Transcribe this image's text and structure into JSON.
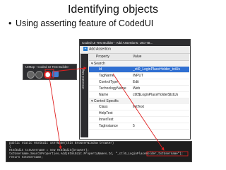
{
  "slide": {
    "title": "Identifying objects",
    "bullet": "Using asserting feature of CodedUI"
  },
  "toolbar": {
    "title": "UIMap - Coded UI Test Builder",
    "icons": [
      "record-icon",
      "pause-icon",
      "target-icon",
      "generate-icon"
    ]
  },
  "window": {
    "title": "Coded UI Test Builder - Add Assertions: UIC+tB...",
    "add_assertion": "Add Assertion",
    "side_tab": "UIControl Map",
    "columns": [
      "Property",
      "Value"
    ],
    "categories": [
      "Search",
      "Control Specific"
    ],
    "rows": [
      {
        "k": "Id",
        "v": "_ctl0_LoginPlaceHolder_txtUs",
        "selected": true
      },
      {
        "k": "TagName",
        "v": "INPUT"
      },
      {
        "k": "ControlType",
        "v": "Edit"
      },
      {
        "k": "TechnologyName",
        "v": "Web"
      },
      {
        "k": "Name",
        "v": "ctl0$LoginPlaceHolder$txtUs"
      }
    ],
    "rows2": [
      {
        "k": "Class",
        "v": "InitText"
      },
      {
        "k": "HelpText",
        "v": ""
      },
      {
        "k": "InnerText",
        "v": ""
      },
      {
        "k": "TagInstance",
        "v": "5"
      }
    ]
  },
  "code": {
    "lines": [
      "public static HtmlEdit userName(this BrowserWindow browser)",
      "{",
      "    HtmlEdit txtUsername = new HtmlEdit(browser);",
      "    txtUsername.SearchProperties.Add(HtmlEdit.PropertyNames.Id, \"_ctl0_LoginPlaceHolder_txtUsername\");",
      "    return txtUsername;"
    ]
  },
  "colors": {
    "highlight": "#2f6fd2",
    "arrow": "#e02020",
    "dark": "#2d2d30"
  }
}
